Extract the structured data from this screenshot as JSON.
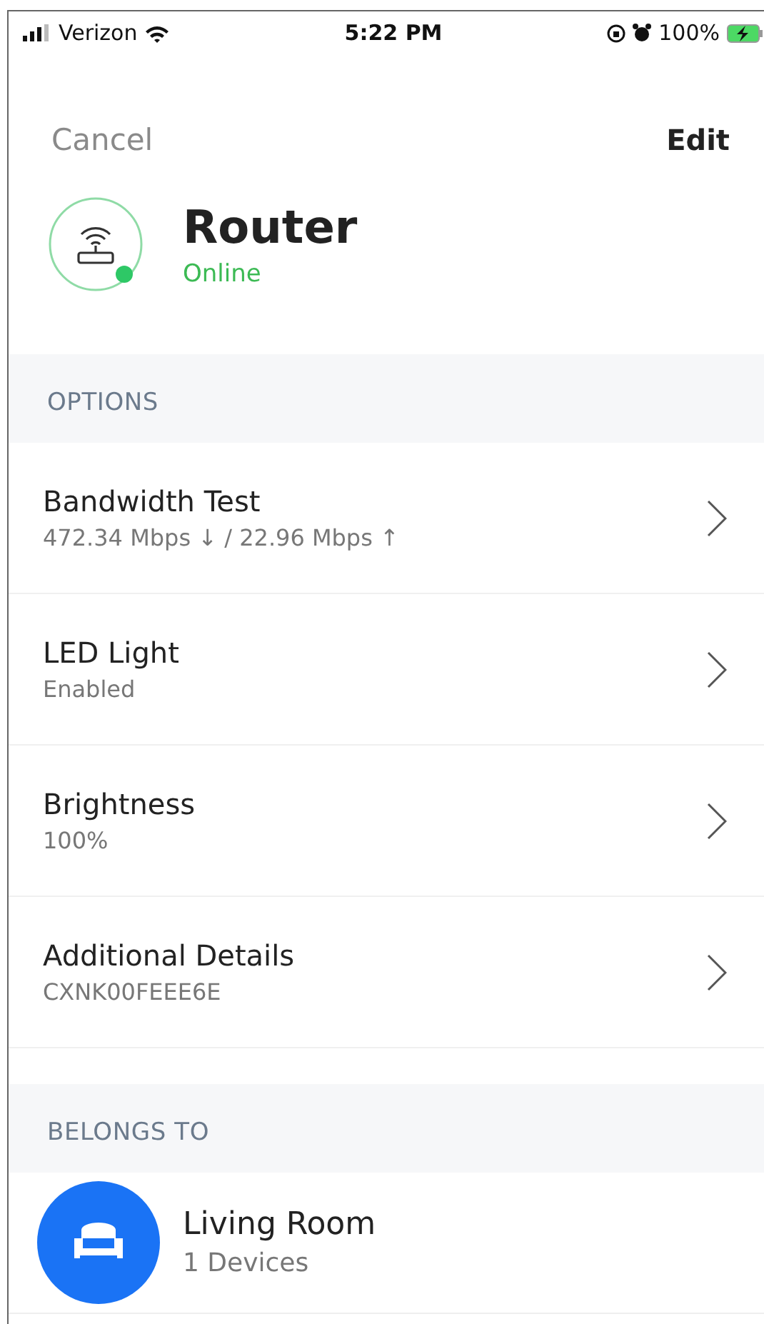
{
  "status_bar": {
    "carrier": "Verizon",
    "time": "5:22 PM",
    "battery": "100%"
  },
  "nav": {
    "cancel": "Cancel",
    "edit": "Edit"
  },
  "device": {
    "name": "Router",
    "status": "Online"
  },
  "options": {
    "title": "OPTIONS",
    "items": [
      {
        "title": "Bandwidth Test",
        "value": "472.34 Mbps ↓ / 22.96 Mbps ↑"
      },
      {
        "title": "LED Light",
        "value": "Enabled"
      },
      {
        "title": "Brightness",
        "value": "100%"
      },
      {
        "title": "Additional Details",
        "value": "CXNK00FEEE6E"
      }
    ]
  },
  "belongs_to": {
    "title": "BELONGS TO",
    "room": {
      "name": "Living Room",
      "count": "1 Devices"
    }
  }
}
